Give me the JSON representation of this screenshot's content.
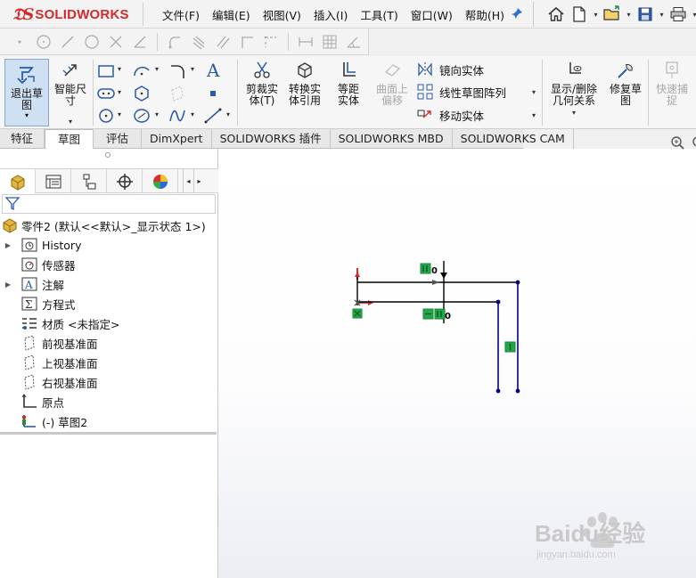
{
  "app": {
    "brand": "SOLIDWORKS",
    "brand_color": "#d42a2a"
  },
  "menu": [
    "文件(F)",
    "编辑(E)",
    "视图(V)",
    "插入(I)",
    "工具(T)",
    "窗口(W)",
    "帮助(H)"
  ],
  "command_manager": {
    "exit_sketch": "退出草图",
    "smart_dimension": "智能尺寸",
    "trim": "剪裁实体(T)",
    "convert": "转换实体引用",
    "offset": "等距实体",
    "surface_offset": "曲面上偏移",
    "mirror": "镜向实体",
    "linear_pattern": "线性草图阵列",
    "move": "移动实体",
    "show_relations": "显示/删除几何关系",
    "repair_sketch": "修复草图",
    "quick_snaps": "快速捕捉"
  },
  "tabs": [
    "特征",
    "草图",
    "评估",
    "DimXpert",
    "SOLIDWORKS 插件",
    "SOLIDWORKS MBD",
    "SOLIDWORKS CAM"
  ],
  "active_tab_index": 1,
  "tree": {
    "root": "零件2 (默认<<默认>_显示状态 1>)",
    "items": [
      {
        "label": "History",
        "expandable": true,
        "icon": "history-icon"
      },
      {
        "label": "传感器",
        "expandable": false,
        "icon": "sensor-icon"
      },
      {
        "label": "注解",
        "expandable": true,
        "icon": "annotation-icon"
      },
      {
        "label": "方程式",
        "expandable": false,
        "icon": "equation-icon"
      },
      {
        "label": "材质 <未指定>",
        "expandable": false,
        "icon": "material-icon"
      },
      {
        "label": "前视基准面",
        "expandable": false,
        "icon": "plane-icon"
      },
      {
        "label": "上视基准面",
        "expandable": false,
        "icon": "plane-icon"
      },
      {
        "label": "右视基准面",
        "expandable": false,
        "icon": "plane-icon"
      },
      {
        "label": "原点",
        "expandable": false,
        "icon": "origin-icon"
      },
      {
        "label": "(-) 草图2",
        "expandable": false,
        "icon": "sketch-icon"
      }
    ]
  },
  "sketch": {
    "relation_zero_labels": [
      "0",
      "0"
    ],
    "line_color": "#00008b",
    "relation_color": "#22a84a"
  },
  "watermark": {
    "text": "Baidu经验",
    "url": "jingyan.baidu.com"
  }
}
